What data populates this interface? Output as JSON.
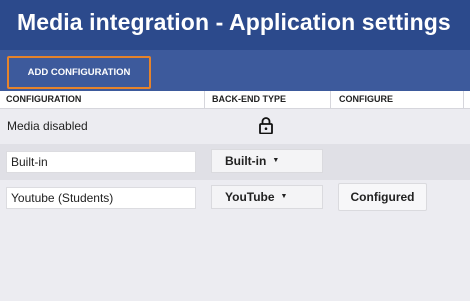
{
  "page": {
    "title": "Media integration - Application settings"
  },
  "toolbar": {
    "add_label": "ADD CONFIGURATION"
  },
  "table": {
    "columns": [
      "CONFIGURATION",
      "BACK-END TYPE",
      "CONFIGURE"
    ],
    "rows": [
      {
        "name": "Media disabled",
        "backend": "",
        "locked": true,
        "configure": ""
      },
      {
        "name": "Built-in",
        "backend": "Built-in",
        "configure": ""
      },
      {
        "name": "Youtube (Students)",
        "backend": "YouTube",
        "configure": "Configured"
      }
    ]
  },
  "icons": {
    "lock": "lock-icon",
    "caret": "caret-down-icon"
  },
  "colors": {
    "title_bar": "#2c4a8c",
    "toolbar": "#3d5a9c",
    "highlight_border": "#e6832b",
    "background": "#ececf1",
    "row_alt": "#e0e0e6"
  }
}
